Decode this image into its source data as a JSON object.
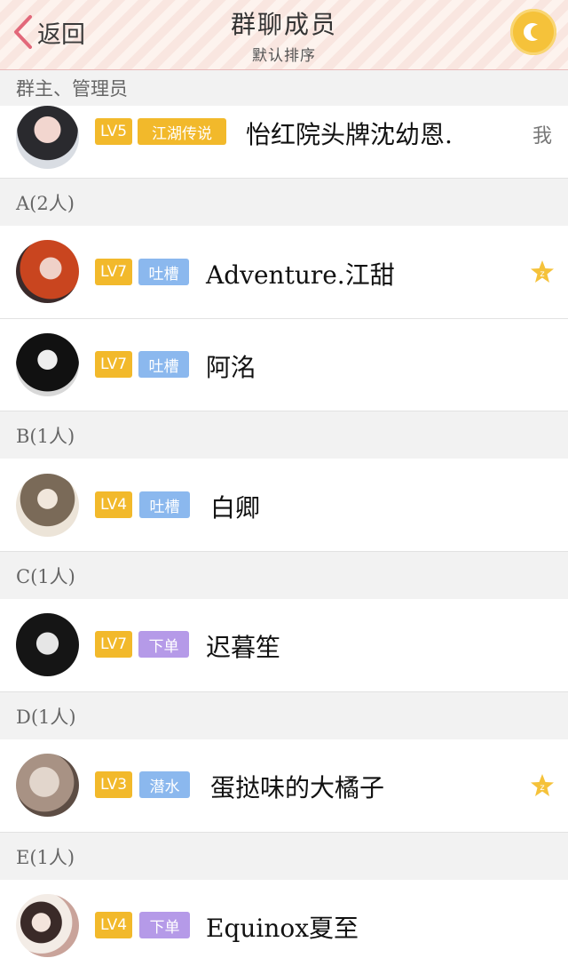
{
  "header": {
    "back_label": "返回",
    "title": "群聊成员",
    "subtitle": "默认排序"
  },
  "colors": {
    "lv": "#f2b92b",
    "role_blue": "#8bb8ee",
    "role_purple": "#b59ae8",
    "role_gold": "#f2b92b",
    "star": "#f5c23a"
  },
  "sections": [
    {
      "header": "群主、管理员"
    },
    {
      "header": "A(2人)"
    },
    {
      "header": "B(1人)"
    },
    {
      "header": "C(1人)"
    },
    {
      "header": "D(1人)"
    },
    {
      "header": "E(1人)"
    }
  ],
  "members": [
    {
      "level": "LV5",
      "role": "江湖传说",
      "name": "怡红院头牌沈幼恩.",
      "me": "我"
    },
    {
      "level": "LV7",
      "role": "吐槽",
      "name": "Adventure.江甜",
      "star_icon": "star-z-icon"
    },
    {
      "level": "LV7",
      "role": "吐槽",
      "name": "阿洺"
    },
    {
      "level": "LV4",
      "role": "吐槽",
      "name": "白卿"
    },
    {
      "level": "LV7",
      "role": "下单",
      "name": "迟暮笙"
    },
    {
      "level": "LV3",
      "role": "潜水",
      "name": "蛋挞味的大橘子",
      "star_icon": "star-z-icon"
    },
    {
      "level": "LV4",
      "role": "下单",
      "name": "Equinox夏至"
    }
  ]
}
